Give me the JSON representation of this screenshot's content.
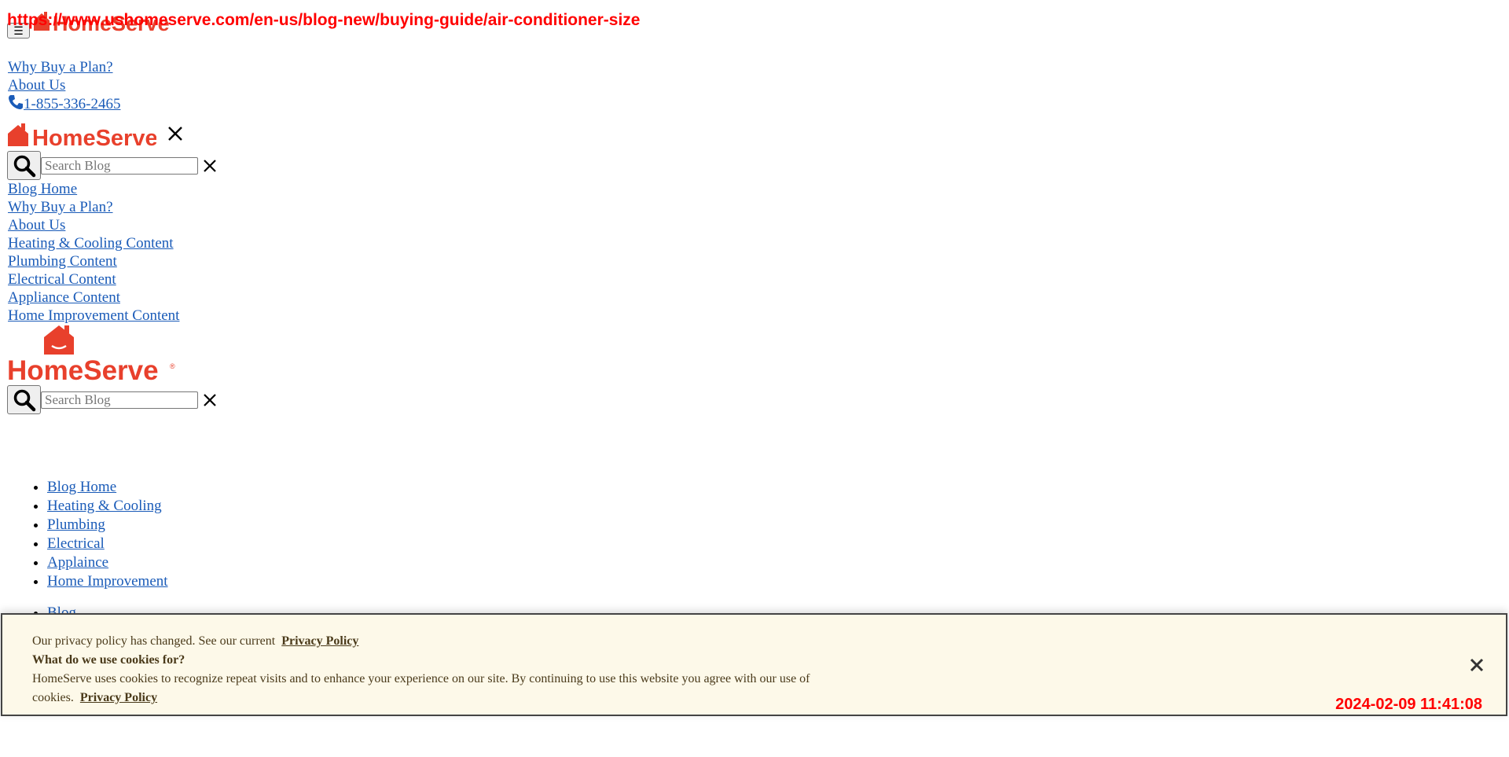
{
  "overlay": {
    "url": "https://www.ushomeserve.com/en-us/blog-new/buying-guide/air-conditioner-size",
    "timestamp": "2024-02-09 11:41:08"
  },
  "brand": {
    "logo_text": "HomeServe",
    "color": "#e8402c"
  },
  "top_links": {
    "why_buy": "Why Buy a Plan?",
    "about": "About Us",
    "phone": "1-855-336-2465"
  },
  "search": {
    "placeholder": "Search Blog"
  },
  "mobile_nav": [
    "Blog Home",
    "Why Buy a Plan?",
    "About Us",
    "Heating & Cooling Content",
    "Plumbing Content",
    "Electrical Content",
    "Appliance Content",
    "Home Improvement Content"
  ],
  "category_nav": [
    "Blog Home",
    "Heating & Cooling",
    "Plumbing",
    "Electrical",
    "Applaince",
    "Home Improvement"
  ],
  "breadcrumb": [
    "Blog"
  ],
  "cookie": {
    "line1": "Our privacy policy has changed. See our current",
    "link1": "Privacy Policy",
    "heading": "What do we use cookies for?",
    "body": "HomeServe uses cookies to recognize repeat visits and to enhance your experience on our site. By continuing to use this website you agree with our use of cookies.",
    "link2": "Privacy Policy"
  }
}
